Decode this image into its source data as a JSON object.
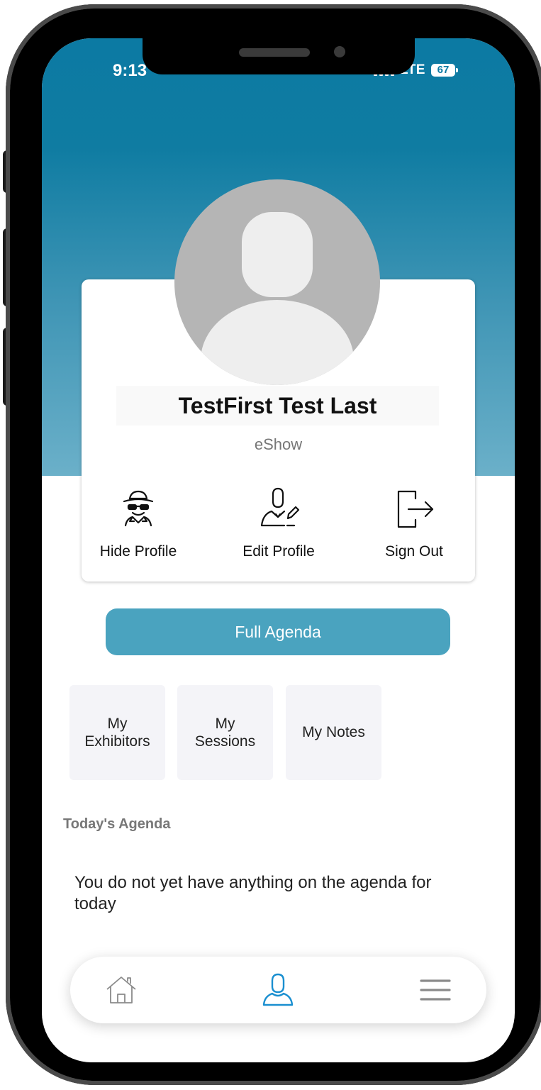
{
  "status_bar": {
    "time": "9:13",
    "network": "LTE",
    "battery": "67"
  },
  "profile": {
    "name": "TestFirst Test Last",
    "organization": "eShow",
    "actions": [
      {
        "label": "Hide Profile",
        "icon": "spy-icon"
      },
      {
        "label": "Edit Profile",
        "icon": "user-edit-icon"
      },
      {
        "label": "Sign Out",
        "icon": "sign-out-icon"
      }
    ]
  },
  "full_agenda_label": "Full Agenda",
  "tiles": [
    {
      "label": "My\nExhibitors"
    },
    {
      "label": "My\nSessions"
    },
    {
      "label": "My Notes"
    }
  ],
  "todays_agenda": {
    "heading": "Today's Agenda",
    "empty_message": "You do not yet have anything on the agenda for today"
  },
  "tab_bar": {
    "items": [
      {
        "name": "home",
        "icon": "home-icon"
      },
      {
        "name": "profile",
        "icon": "user-icon",
        "active": true
      },
      {
        "name": "menu",
        "icon": "hamburger-menu-icon"
      }
    ]
  },
  "colors": {
    "accent": "#4aa3bf",
    "header_top": "#0c7aa3",
    "active_tab": "#1a8fd0"
  }
}
